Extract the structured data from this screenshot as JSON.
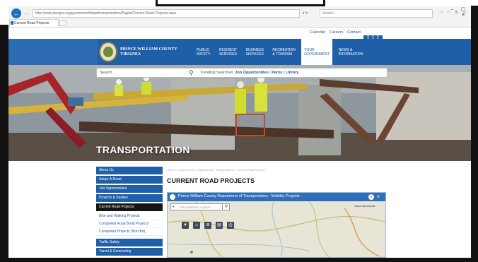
{
  "browser": {
    "address": "http://www.pwcgov.org/government/dept/transportation/Pages/Current-Road-Projects.aspx",
    "search_placeholder": "Search...",
    "tab_title": "Current Road Projects",
    "back_glyph": "←",
    "forward_glyph": "→",
    "window_controls": "– ▢ ✕",
    "tool_icons": "⌂ ☆ ⚙ ☺",
    "address_actions": "▾ ↻"
  },
  "utility": {
    "links": [
      "Calendar",
      "Careers",
      "Contact"
    ]
  },
  "brand": {
    "line1": "PRINCE WILLIAM COUNTY",
    "line2": "VIRGINIA"
  },
  "nav": {
    "items": [
      {
        "line1": "PUBLIC",
        "line2": "SAFETY"
      },
      {
        "line1": "RESIDENT",
        "line2": "SERVICES"
      },
      {
        "line1": "BUSINESS",
        "line2": "SERVICES"
      },
      {
        "line1": "RECREATION",
        "line2": "& TOURISM"
      },
      {
        "line1": "YOUR",
        "line2": "GOVERNMENT"
      },
      {
        "line1": "NEWS &",
        "line2": "INFORMATION"
      }
    ]
  },
  "site_search": {
    "placeholder": "Search",
    "trending_label": "Trending Searches:",
    "trending_links": [
      "Job Opportunities",
      "Parks",
      "Library"
    ]
  },
  "hero": {
    "title": "TRANSPORTATION"
  },
  "sidebar": {
    "items": [
      "About Us",
      "Adopt-A-Road",
      "Job Opportunities",
      "Projects & Studies"
    ],
    "active": "Current Road Projects",
    "sub_items": [
      "Bike and Walking Projects",
      "Completed Road Bond Projects",
      "Completed Projects (Non-Bd)"
    ],
    "bottom_items": [
      "Traffic Safety",
      "Travel & Commuting"
    ]
  },
  "breadcrumb": "Home > Government > Departments > Transportation > Current Road Projects",
  "page": {
    "title": "CURRENT ROAD PROJECTS"
  },
  "map_widget": {
    "title": "Prince William County Department of Transportation - Mobility Projects",
    "search_placeholder": "Find address or place",
    "info_glyph": "i",
    "menu_glyph": "≡",
    "dropdown_glyph": "▾",
    "search_glyph": "⚲",
    "tool_glyphs": [
      "▼",
      "⌂",
      "⊕",
      "▤",
      "⎙"
    ],
    "place_label": "West Gainesville"
  },
  "colors": {
    "brand_blue": "#1f5fa8",
    "active_dark": "#151515",
    "map_header": "#2f6fb9"
  }
}
